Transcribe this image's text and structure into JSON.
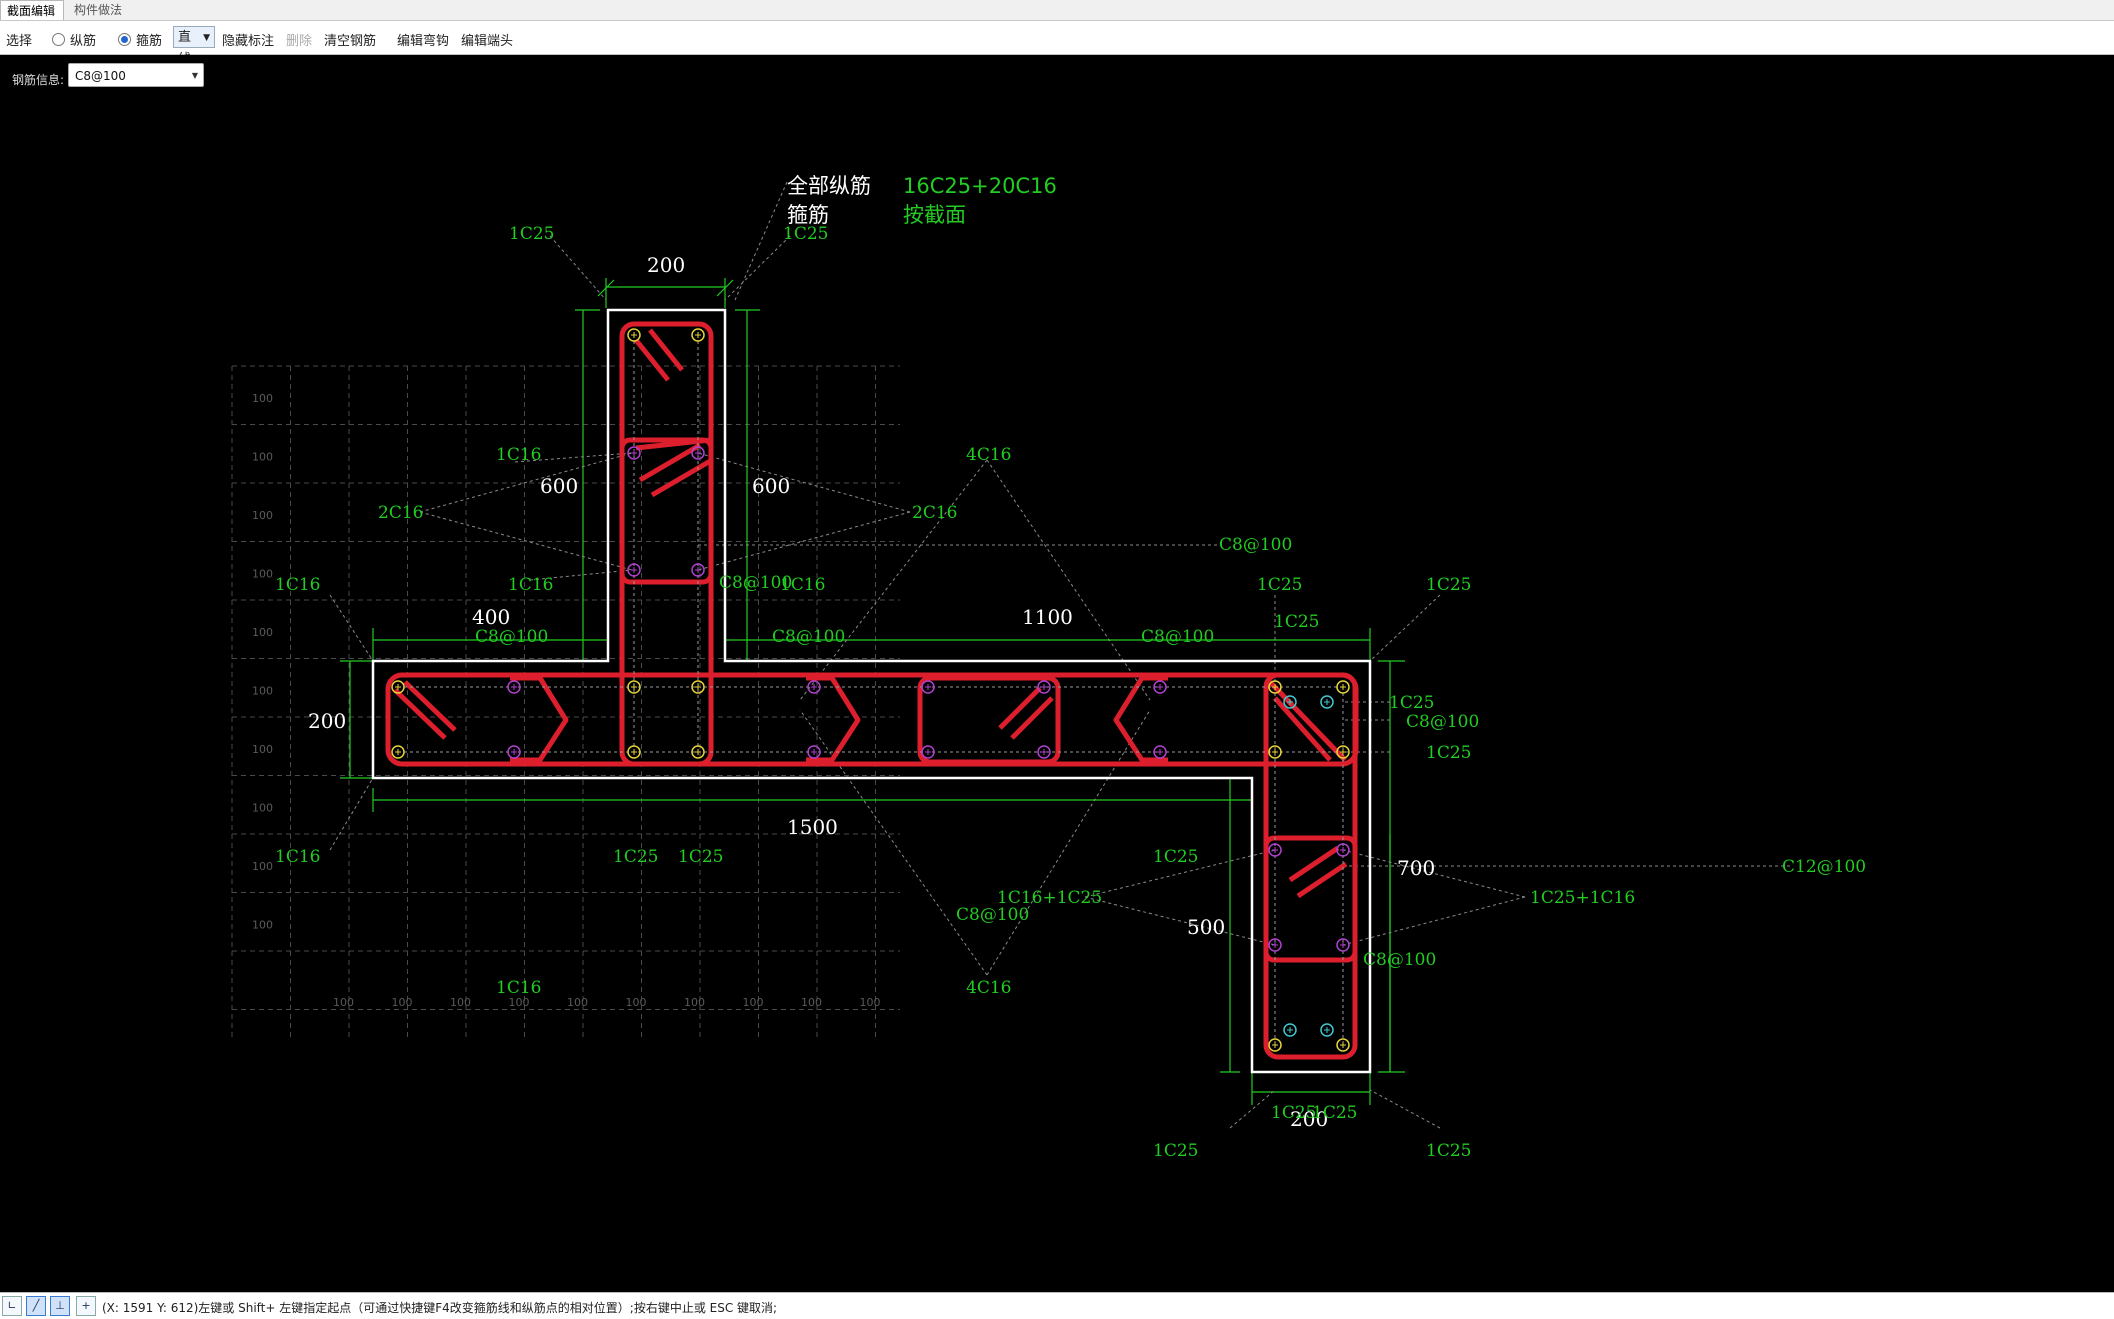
{
  "tabs": [
    {
      "label": "截面编辑",
      "active": true
    },
    {
      "label": "构件做法",
      "active": false
    }
  ],
  "toolbar": {
    "select_label": "选择",
    "radio_longitudinal": "纵筋",
    "radio_stirrup": "箍筋",
    "line_mode": "直线",
    "hide_labels": "隐藏标注",
    "delete": "删除",
    "clear_rebar": "清空钢筋",
    "edit_bend": "编辑弯钩",
    "edit_end": "编辑端头"
  },
  "info": {
    "label": "钢筋信息:",
    "value": "C8@100"
  },
  "summary": {
    "all_long_label": "全部纵筋",
    "all_long_value": "16C25+20C16",
    "stirrup_label": "箍筋",
    "stirrup_value": "按截面"
  },
  "dimensions": {
    "top_width": "200",
    "left_600": "600",
    "right_600": "600",
    "d400": "400",
    "d1100": "1100",
    "d200_left": "200",
    "d1500": "1500",
    "d700": "700",
    "d500": "500",
    "bottom_200": "200"
  },
  "rebar_labels": {
    "c25_a": "1C25",
    "c25_b": "1C25",
    "c16_a": "1C16",
    "c16_b": "1C16",
    "c16_left1": "1C16",
    "c16_left2": "1C16",
    "two_c16_left": "2C16",
    "two_c16_right": "2C16",
    "four_c16_top": "4C16",
    "four_c16_bottom": "4C16",
    "c8_a": "C8@100",
    "c8_b": "C8@100",
    "c8_c": "C8@100",
    "c8_d": "C8@100",
    "c8_e": "C8@100",
    "c8_f": "C8@100",
    "c8_g": "C8@100",
    "c8_h": "C8@100",
    "c16_right_mid": "1C16",
    "c25_r1": "1C25",
    "c25_r2": "1C25",
    "c25_r3": "1C25",
    "c25_r4": "1C25",
    "c25_r5": "1C25",
    "c25_bottom_left": "1C25",
    "c25_bottom_mid": "1C25",
    "c16_bottom_left": "1C16",
    "c16_bottom_left2": "1C16",
    "c16c25": "1C16+1C25",
    "c25c16": "1C25+1C16",
    "c12": "C12@100",
    "c25_leg_l": "1C25",
    "c25_foot_l": "1C25",
    "c25_foot_r": "1C25",
    "c25_pair": "1C25",
    "c25_pair2": "1C25"
  },
  "grid_labels": {
    "row": [
      "100",
      "100",
      "100",
      "100",
      "100",
      "100",
      "100",
      "100",
      "100",
      "100"
    ],
    "col": [
      "100",
      "100",
      "100",
      "100",
      "100",
      "100",
      "100",
      "100",
      "100",
      "100"
    ]
  },
  "status": {
    "message": "(X: 1591 Y: 612)左键或 Shift+ 左键指定起点（可通过快捷键F4改变箍筋线和纵筋点的相对位置）;按右键中止或 ESC 键取消;"
  },
  "colors": {
    "green": "#22cc22",
    "red": "#dd1f2d",
    "white": "#ffffff",
    "grid": "#555555",
    "yellow_pt": "#e6d23a",
    "purple_pt": "#b040d0",
    "cyan_pt": "#40c8d0"
  }
}
